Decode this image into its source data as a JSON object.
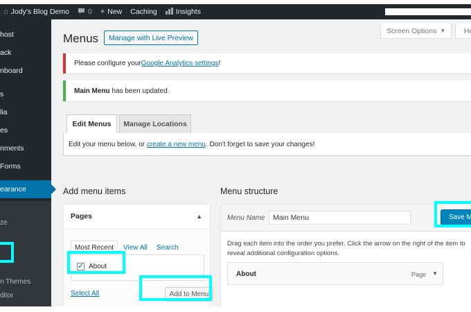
{
  "admin_bar": {
    "site_name": "Jody's Blog Demo",
    "comments_count": "0",
    "new_label": "New",
    "caching_label": "Caching",
    "insights_label": "Insights"
  },
  "sidebar": {
    "items": [
      {
        "label": "host",
        "state": "normal"
      },
      {
        "label": "ack",
        "state": "normal"
      },
      {
        "label": "nboard",
        "state": "normal"
      },
      {
        "label": "s",
        "state": "normal"
      },
      {
        "label": "lia",
        "state": "normal"
      },
      {
        "label": "es",
        "state": "normal"
      },
      {
        "label": "nments",
        "state": "normal"
      },
      {
        "label": "Forms",
        "state": "normal"
      },
      {
        "label": "earance",
        "state": "current"
      }
    ],
    "submenu": [
      {
        "label": "ze"
      },
      {
        "label": "n Themes"
      },
      {
        "label": "ditor"
      }
    ],
    "current_color": "#0073aa"
  },
  "header": {
    "screen_options_label": "Screen Options",
    "help_label": "He",
    "page_title": "Menus",
    "title_action_label": "Manage with Live Preview"
  },
  "notices": {
    "error_prefix": "Please configure your ",
    "error_link": "Google Analytics settings",
    "error_suffix": "!",
    "success_strong": "Main Menu",
    "success_text": " has been updated."
  },
  "tabs": [
    {
      "label": "Edit Menus",
      "active": true
    },
    {
      "label": "Manage Locations",
      "active": false
    }
  ],
  "manage_box": {
    "prefix": "Edit your menu below, or ",
    "link": "create a new menu",
    "suffix": ". Don't forget to save your changes!"
  },
  "add_items": {
    "title": "Add menu items",
    "panel_title": "Pages",
    "subtabs": [
      "Most Recent",
      "View All",
      "Search"
    ],
    "items": [
      {
        "label": "About",
        "checked": true
      }
    ],
    "select_all": "Select All",
    "add_button": "Add to Menu"
  },
  "structure": {
    "title": "Menu structure",
    "menu_name_label": "Menu Name",
    "menu_name_value": "Main Menu",
    "save_button": "Save Menu",
    "instructions": "Drag each item into the order you prefer. Click the arrow on the right of the item to reveal additional configuration options.",
    "items": [
      {
        "title": "About",
        "type": "Page"
      }
    ]
  },
  "highlight_color": "#00ffff"
}
